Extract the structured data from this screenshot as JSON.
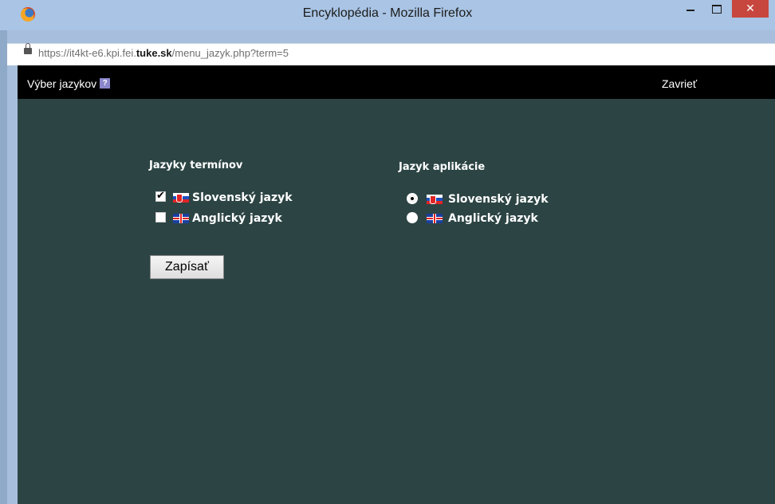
{
  "window": {
    "title": "Encyklopédia - Mozilla Firefox",
    "close_glyph": "✕"
  },
  "address": {
    "url_prefix": "https://it4kt-e6.kpi.fei.",
    "url_domain": "tuke.sk",
    "url_suffix": "/menu_jazyk.php?term=5"
  },
  "navbar": {
    "title": "Výber jazykov",
    "help_glyph": "?",
    "close_label": "Zavrieť"
  },
  "terms_languages": {
    "title": "Jazyky termínov",
    "options": [
      {
        "label": "Slovenský jazyk",
        "flag": "sk-flag-icon",
        "checked": true
      },
      {
        "label": "Anglický jazyk",
        "flag": "uk-flag-icon",
        "checked": false
      }
    ]
  },
  "app_language": {
    "title": "Jazyk aplikácie",
    "options": [
      {
        "label": "Slovenský jazyk",
        "flag": "sk-flag-icon",
        "selected": true
      },
      {
        "label": "Anglický jazyk",
        "flag": "uk-flag-icon",
        "selected": false
      }
    ]
  },
  "submit_label": "Zapísať",
  "colors": {
    "content_bg": "#2c4444",
    "navbar_bg": "#000000",
    "close_button": "#c7473e"
  }
}
